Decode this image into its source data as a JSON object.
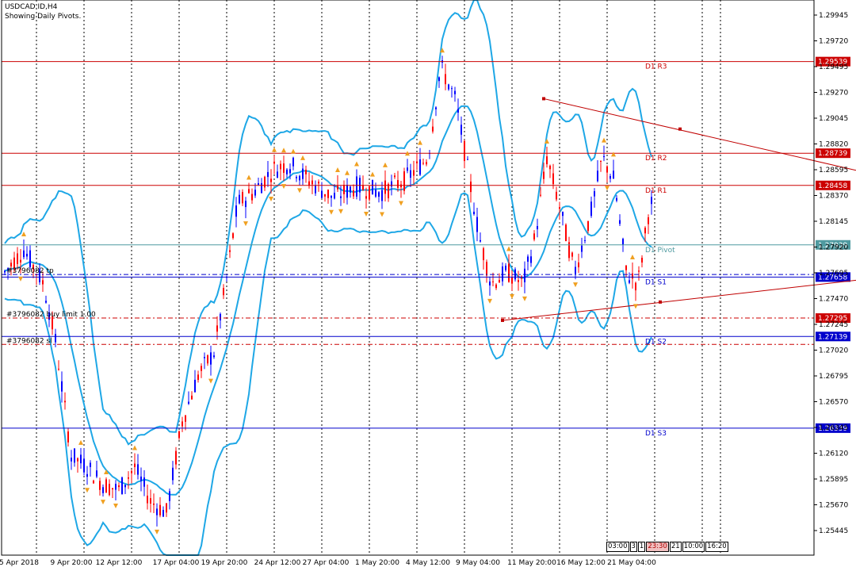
{
  "header": {
    "symbol": "USDCAD.ID,H4",
    "subtitle": "Showing Daily Pivots."
  },
  "colors": {
    "bull": "#0000ff",
    "bear": "#ff0000",
    "bands": "#1ea7e6",
    "resistance": "#cc0000",
    "support": "#0000cc",
    "pivot": "#4f9aa0",
    "trend": "#c00000",
    "fractal": "#f0a020"
  },
  "price_axis": {
    "ticks": [
      "1.29945",
      "1.29720",
      "1.29495",
      "1.29270",
      "1.29045",
      "1.28820",
      "1.28595",
      "1.28370",
      "1.28145",
      "1.27920",
      "1.27695",
      "1.27470",
      "1.27245",
      "1.27020",
      "1.26795",
      "1.26570",
      "1.26345",
      "1.26120",
      "1.25895",
      "1.25670",
      "1.25445"
    ],
    "min": 1.2532,
    "max": 1.3008
  },
  "time_axis": {
    "labels": [
      "5 Apr 2018",
      "9 Apr 20:00",
      "12 Apr 12:00",
      "17 Apr 04:00",
      "19 Apr 20:00",
      "24 Apr 12:00",
      "27 Apr 04:00",
      "1 May 20:00",
      "4 May 12:00",
      "9 May 04:00",
      "11 May 20:00",
      "16 May 12:00",
      "21 May 04:00"
    ]
  },
  "pivots": [
    {
      "name": "D1 R3",
      "label": "D1  R3",
      "value": 1.29539,
      "tag": "1.29539",
      "kind": "resistance"
    },
    {
      "name": "D1 R2",
      "label": "D1  R2",
      "value": 1.28739,
      "tag": "1.28739",
      "kind": "resistance"
    },
    {
      "name": "D1 R1",
      "label": "D1  R1",
      "value": 1.28458,
      "tag": "1.28458",
      "kind": "resistance"
    },
    {
      "name": "D1 Pivot",
      "label": "D1  Pivot",
      "value": 1.27939,
      "tag": "1.27939",
      "kind": "pivot"
    },
    {
      "name": "D1 S1",
      "label": "D1  S1",
      "value": 1.27658,
      "tag": "1.27658",
      "kind": "support"
    },
    {
      "name": "D1 S2",
      "label": "D1  S2",
      "value": 1.27139,
      "tag": "1.27139",
      "kind": "support"
    },
    {
      "name": "D1 S3",
      "label": "D1  S3",
      "value": 1.26339,
      "tag": "1.26339",
      "kind": "support"
    }
  ],
  "orders": [
    {
      "label": "#3796082 tp",
      "value": 1.2768
    },
    {
      "label": "#3796082 buy limit 1.00",
      "value": 1.273
    },
    {
      "label": "#3796082 sl",
      "value": 1.2707
    }
  ],
  "order_tag": "1.27295",
  "timebox": [
    "03:00",
    "3",
    "1",
    "23:30",
    "21",
    "10:00",
    "16:20"
  ]
}
